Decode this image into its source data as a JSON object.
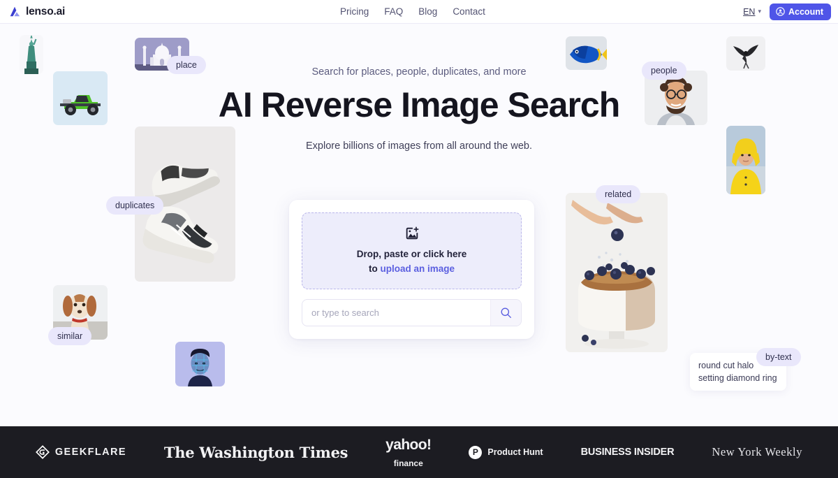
{
  "header": {
    "brand": "lenso.ai",
    "brand_icon": "lenso-logo-icon",
    "nav": [
      {
        "label": "Pricing"
      },
      {
        "label": "FAQ"
      },
      {
        "label": "Blog"
      },
      {
        "label": "Contact"
      }
    ],
    "language": {
      "label": "EN",
      "chevron": "⌄"
    },
    "account": {
      "label": "Account",
      "icon": "user-circle-icon"
    }
  },
  "hero": {
    "eyebrow": "Search for places, people, duplicates, and more",
    "title": "AI Reverse Image Search",
    "subtitle": "Explore billions of images from all around the web."
  },
  "search_card": {
    "dropzone": {
      "icon": "image-plus-icon",
      "line1": "Drop, paste or click here",
      "line2_prefix": "to ",
      "line2_link": "upload an image"
    },
    "input": {
      "value": "",
      "placeholder": "or type to search"
    },
    "submit": {
      "icon": "search-icon",
      "label": "Search"
    }
  },
  "pills": [
    {
      "label": "place"
    },
    {
      "label": "duplicates"
    },
    {
      "label": "similar"
    },
    {
      "label": "people"
    },
    {
      "label": "related"
    },
    {
      "label": "by-text"
    }
  ],
  "by_text_card": {
    "text": "round cut halo setting diamond ring"
  },
  "thumbnails": [
    {
      "name": "statue-of-liberty"
    },
    {
      "name": "green-truck"
    },
    {
      "name": "taj-mahal"
    },
    {
      "name": "sneakers"
    },
    {
      "name": "dog-on-beach"
    },
    {
      "name": "face-scan-portrait"
    },
    {
      "name": "blue-fish"
    },
    {
      "name": "man-with-glasses"
    },
    {
      "name": "black-bird"
    },
    {
      "name": "woman-yellow-raincoat"
    },
    {
      "name": "blueberry-cake"
    }
  ],
  "footer": {
    "logos": [
      {
        "name": "geekflare",
        "text": "GEEKFLARE"
      },
      {
        "name": "the-washington-times",
        "text": "The Washington Times"
      },
      {
        "name": "yahoo-finance",
        "text": "yahoo!",
        "sub": "finance"
      },
      {
        "name": "product-hunt",
        "text": "Product Hunt",
        "mark": "P"
      },
      {
        "name": "business-insider",
        "text": "BUSINESS INSIDER"
      },
      {
        "name": "new-york-weekly",
        "text": "New York Weekly"
      }
    ]
  },
  "colors": {
    "accent": "#4f55e8",
    "link": "#5b5fe0",
    "pill_bg": "#e9e7fb",
    "dropzone_bg": "#ededfb",
    "page_bg": "#fbfbfe",
    "footer_bg": "#1c1c22"
  }
}
